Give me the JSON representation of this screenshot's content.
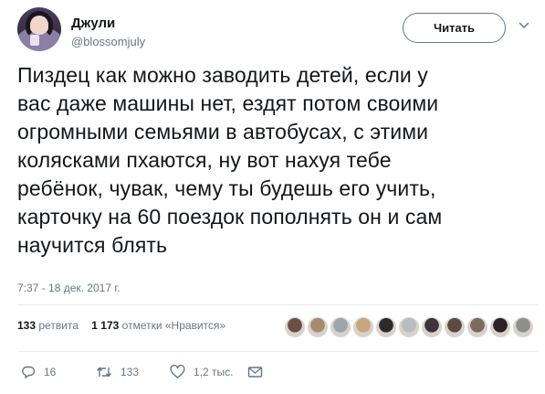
{
  "user": {
    "name": "Джули",
    "handle": "@blossomjuly",
    "follow_label": "Читать"
  },
  "tweet": {
    "lines": [
      "Пиздец как можно заводить детей, если у",
      "вас даже машины нет, ездят потом своими",
      "огромными семьями в автобусах, с этими",
      "колясками пхаются, ну вот нахуя тебе",
      "ребёнок, чувак, чему ты будешь его учить,",
      "карточку на 60 поездок пополнять он и сам",
      "научится блять"
    ],
    "timestamp": "7:37 - 18 дек. 2017 г."
  },
  "stats": {
    "retweets_count": "133",
    "retweets_label": "ретвита",
    "likes_count": "1 173",
    "likes_label": "отметки «Нравится»"
  },
  "likers": [
    {
      "color": "#6b4f47"
    },
    {
      "color": "#a88b6e"
    },
    {
      "color": "#9ba6ad"
    },
    {
      "color": "#c9a57a"
    },
    {
      "color": "#2e2a2c"
    },
    {
      "color": "#b9bcc0"
    },
    {
      "color": "#3d3338"
    },
    {
      "color": "#5c4a44"
    },
    {
      "color": "#7a6a60"
    },
    {
      "color": "#2b2327"
    },
    {
      "color": "#8e8f8a"
    }
  ],
  "actions": {
    "reply_count": "16",
    "retweet_count": "133",
    "like_count": "1,2 тыс.",
    "reply_icon": "reply-icon",
    "retweet_icon": "retweet-icon",
    "like_icon": "heart-icon",
    "dm_icon": "envelope-icon"
  },
  "colors": {
    "text": "#14171a",
    "secondary": "#657786",
    "divider": "#e6ecf0"
  }
}
